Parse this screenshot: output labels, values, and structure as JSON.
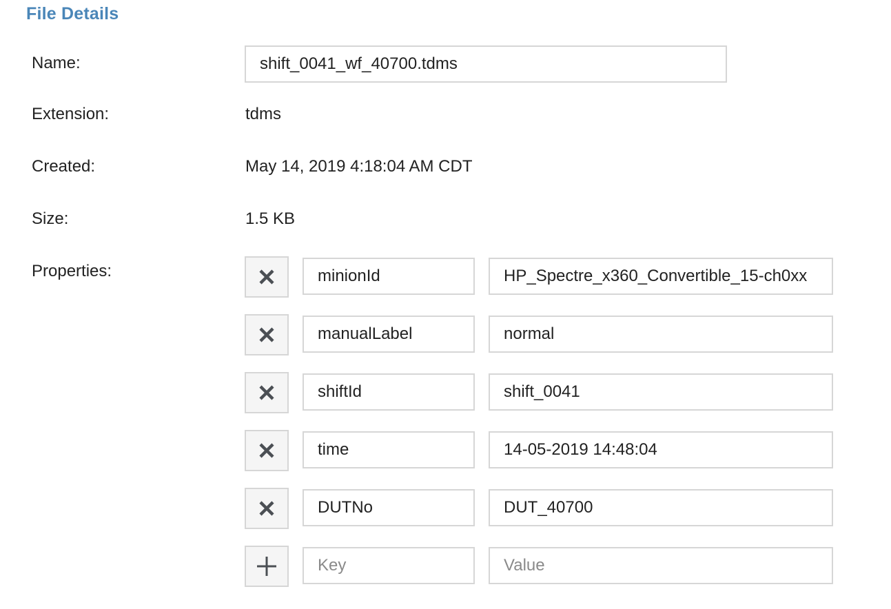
{
  "title": "File Details",
  "fields": {
    "name_label": "Name:",
    "name_value": "shift_0041_wf_40700.tdms",
    "extension_label": "Extension:",
    "extension_value": "tdms",
    "created_label": "Created:",
    "created_value": "May 14, 2019 4:18:04 AM CDT",
    "size_label": "Size:",
    "size_value": "1.5 KB",
    "properties_label": "Properties:"
  },
  "properties": [
    {
      "key": "minionId",
      "value": "HP_Spectre_x360_Convertible_15-ch0xx"
    },
    {
      "key": "manualLabel",
      "value": "normal"
    },
    {
      "key": "shiftId",
      "value": "shift_0041"
    },
    {
      "key": "time",
      "value": "14-05-2019 14:48:04"
    },
    {
      "key": "DUTNo",
      "value": "DUT_40700"
    }
  ],
  "new_property": {
    "key_placeholder": "Key",
    "value_placeholder": "Value"
  },
  "icons": {
    "remove": "close-icon",
    "add": "plus-icon"
  },
  "colors": {
    "title": "#4a86b8",
    "icon": "#4b4f54",
    "border": "#d6d6d6"
  }
}
